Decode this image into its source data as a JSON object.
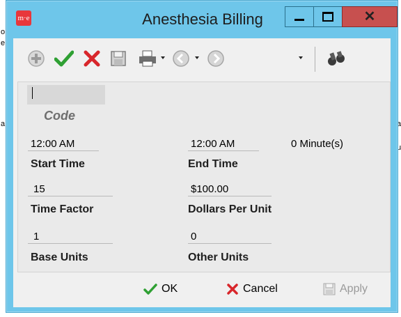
{
  "background": {
    "fragments": [
      "o",
      "e",
      "a",
      "a",
      "u"
    ]
  },
  "window": {
    "app_icon_text": "m·e",
    "title": "Anesthesia Billing"
  },
  "form": {
    "code": {
      "value": "",
      "label": "Code"
    },
    "start_time": {
      "value": "12:00 AM",
      "label": "Start Time"
    },
    "end_time": {
      "value": "12:00 AM",
      "label": "End Time"
    },
    "duration": "0 Minute(s)",
    "time_factor": {
      "value": "15",
      "label": "Time Factor"
    },
    "dollars_per_unit": {
      "value": "$100.00",
      "label": "Dollars Per Unit"
    },
    "base_units": {
      "value": "1",
      "label": "Base Units"
    },
    "other_units": {
      "value": "0",
      "label": "Other Units"
    }
  },
  "buttons": {
    "ok": "OK",
    "cancel": "Cancel",
    "apply": "Apply"
  },
  "colors": {
    "window_frame": "#6ec6ea",
    "close_button": "#c7504f",
    "accept_green": "#2fa033",
    "cancel_red": "#d8262b"
  }
}
